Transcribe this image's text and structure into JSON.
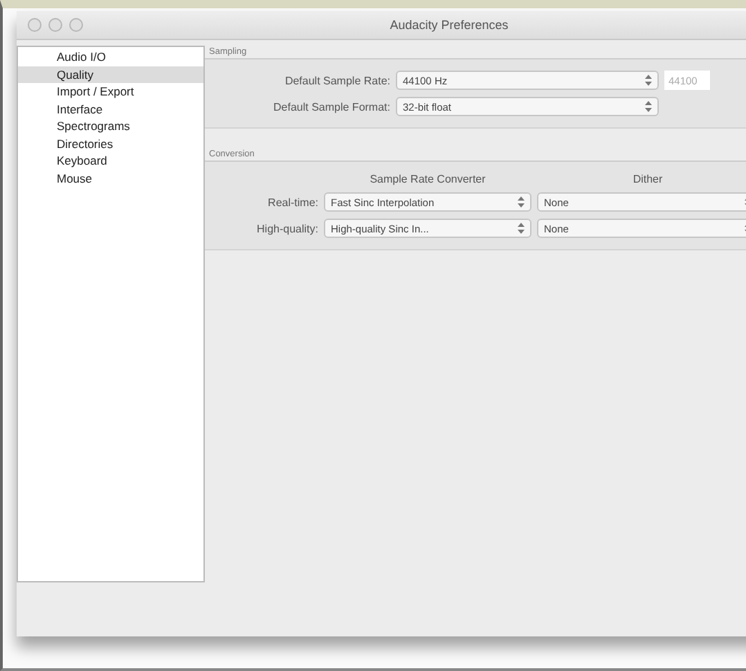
{
  "window": {
    "title": "Audacity Preferences"
  },
  "sidebar": {
    "items": [
      {
        "label": "Audio I/O",
        "selected": false
      },
      {
        "label": "Quality",
        "selected": true
      },
      {
        "label": "Import / Export",
        "selected": false
      },
      {
        "label": "Interface",
        "selected": false
      },
      {
        "label": "Spectrograms",
        "selected": false
      },
      {
        "label": "Directories",
        "selected": false
      },
      {
        "label": "Keyboard",
        "selected": false
      },
      {
        "label": "Mouse",
        "selected": false
      }
    ]
  },
  "sampling": {
    "title": "Sampling",
    "rate_label": "Default Sample Rate:",
    "rate_value": "44100 Hz",
    "rate_field": {
      "value": "44100",
      "disabled": true
    },
    "format_label": "Default Sample Format:",
    "format_value": "32-bit float"
  },
  "conversion": {
    "title": "Conversion",
    "columns": [
      "Sample Rate Converter",
      "Dither"
    ],
    "rows": [
      {
        "label": "Real-time:",
        "converter": "Fast Sinc Interpolation",
        "dither": "None"
      },
      {
        "label": "High-quality:",
        "converter": "High-quality Sinc In...",
        "dither": "None"
      }
    ]
  }
}
